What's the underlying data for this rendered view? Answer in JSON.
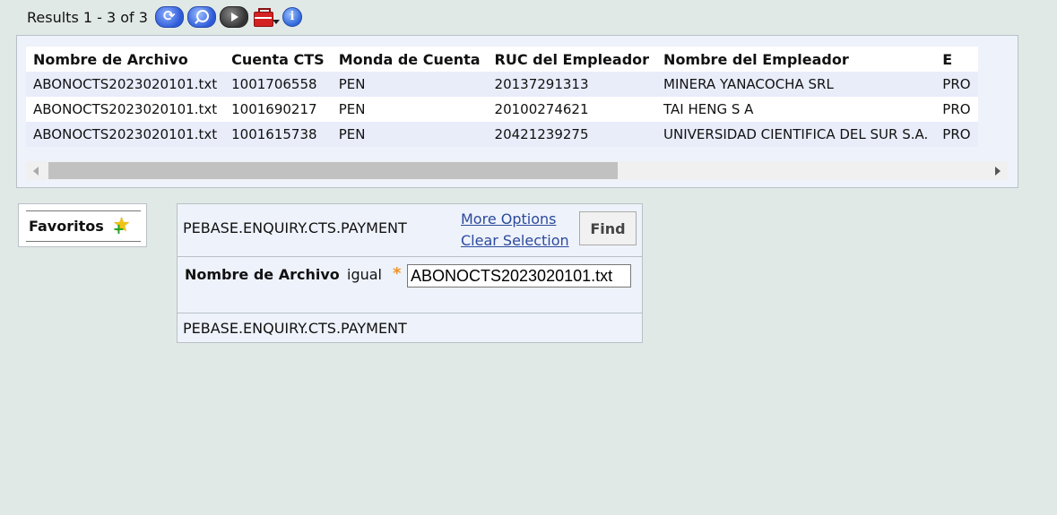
{
  "toolbar": {
    "results_text": "Results 1 - 3 of 3",
    "icons": [
      "refresh-icon",
      "search-icon",
      "play-icon",
      "toolbox-icon",
      "info-icon"
    ]
  },
  "results_table": {
    "columns": [
      "Nombre de Archivo",
      "Cuenta CTS",
      "Monda de Cuenta",
      "RUC del Empleador",
      "Nombre del Empleador",
      "E"
    ],
    "rows": [
      [
        "ABONOCTS2023020101.txt",
        "1001706558",
        "PEN",
        "20137291313",
        "MINERA YANACOCHA SRL",
        "PRO"
      ],
      [
        "ABONOCTS2023020101.txt",
        "1001690217",
        "PEN",
        "20100274621",
        "TAI HENG S A",
        "PRO"
      ],
      [
        "ABONOCTS2023020101.txt",
        "1001615738",
        "PEN",
        "20421239275",
        "UNIVERSIDAD CIENTIFICA DEL SUR S.A.",
        "PRO"
      ]
    ]
  },
  "favorites": {
    "label": "Favoritos"
  },
  "selection": {
    "enquiry_title": "PEBASE.ENQUIRY.CTS.PAYMENT",
    "more_options": "More Options",
    "clear_selection": "Clear Selection",
    "find_label": "Find",
    "field_label": "Nombre de Archivo",
    "operator": "igual",
    "required_mark": "*",
    "field_value": "ABONOCTS2023020101.txt",
    "footer_title": "PEBASE.ENQUIRY.CTS.PAYMENT"
  },
  "colors": {
    "background": "#e1e9e6",
    "panel": "#eef2fb",
    "link": "#2c4a9c",
    "required": "#f19324"
  }
}
